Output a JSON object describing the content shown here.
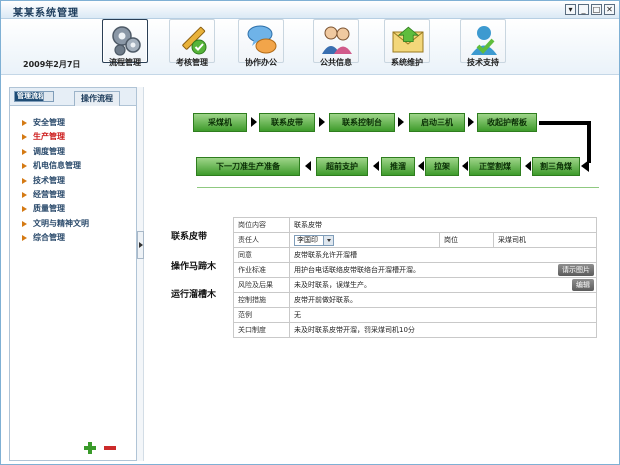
{
  "window": {
    "title": "某某系统管理",
    "controls": [
      "▾",
      "_",
      "□",
      "✕"
    ]
  },
  "toolbar": {
    "date": "2009年2月7日",
    "items": [
      {
        "label": "流程管理",
        "icon": "gears-icon",
        "active": true
      },
      {
        "label": "考核管理",
        "icon": "pencil-check-icon"
      },
      {
        "label": "协作办公",
        "icon": "chat-bubbles-icon"
      },
      {
        "label": "公共信息",
        "icon": "people-icon"
      },
      {
        "label": "系统维护",
        "icon": "envelope-icon"
      },
      {
        "label": "技术支持",
        "icon": "support-person-icon"
      }
    ]
  },
  "sidebar": {
    "tabs": [
      "管理流程",
      "操作流程"
    ],
    "selected_tab": 0,
    "items": [
      "安全管理",
      "生产管理",
      "调度管理",
      "机电信息管理",
      "技术管理",
      "经营管理",
      "质量管理",
      "文明与精神文明",
      "综合管理"
    ],
    "active_item": 1
  },
  "flow": {
    "row1": [
      "采煤机",
      "联系皮带",
      "联系控制台",
      "启动三机",
      "收起护帮板"
    ],
    "row2": [
      "下一刀准生产准备",
      "超前支护",
      "推溜",
      "拉架",
      "正堂割煤",
      "割三角煤"
    ]
  },
  "side_labels": [
    "联系皮带",
    "操作马蹄木",
    "运行溜槽木"
  ],
  "detail": {
    "rows": [
      {
        "key": "岗位内容",
        "value": "联系皮带"
      },
      {
        "key": "责任人",
        "select": "李国印",
        "key2": "岗位",
        "value2": "采煤司机"
      },
      {
        "key": "同意",
        "value": "皮带联系允许开溜槽"
      },
      {
        "key": "作业标准",
        "value": "用护台电话联络皮带联络台开溜槽开溜。",
        "button": "请示图片"
      },
      {
        "key": "风险及后果",
        "value": "未及时联系，误煤生产。",
        "button": "编辑"
      },
      {
        "key": "控制措施",
        "value": "皮带开前做好联系。"
      },
      {
        "key": "范例",
        "value": "无"
      },
      {
        "key": "关口制度",
        "value": "未及时联系皮带开溜，罚采煤司机10分"
      }
    ]
  },
  "colors": {
    "accent": "#1f4c75",
    "step_green": "#3e9b2b",
    "active_nav": "#cc1a1a",
    "nav_arrow": "#d47a14"
  }
}
